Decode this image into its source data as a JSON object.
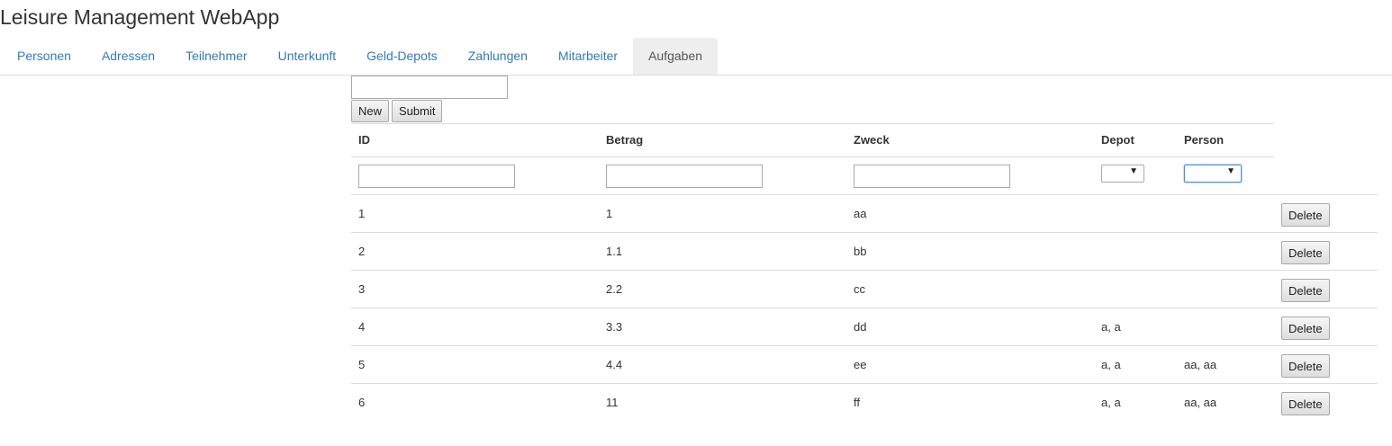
{
  "app": {
    "title": "Leisure Management WebApp"
  },
  "nav": {
    "tabs": [
      {
        "label": "Personen",
        "active": false
      },
      {
        "label": "Adressen",
        "active": false
      },
      {
        "label": "Teilnehmer",
        "active": false
      },
      {
        "label": "Unterkunft",
        "active": false
      },
      {
        "label": "Geld-Depots",
        "active": false
      },
      {
        "label": "Zahlungen",
        "active": false
      },
      {
        "label": "Mitarbeiter",
        "active": false
      },
      {
        "label": "Aufgaben",
        "active": true
      }
    ]
  },
  "toolbar": {
    "search_value": "",
    "new_label": "New",
    "submit_label": "Submit"
  },
  "table": {
    "columns": [
      "ID",
      "Betrag",
      "Zweck",
      "Depot",
      "Person"
    ],
    "filters": {
      "id": "",
      "betrag": "",
      "zweck": "",
      "depot": "",
      "person": ""
    },
    "rows": [
      {
        "id": "1",
        "betrag": "1",
        "zweck": "aa",
        "depot": "",
        "person": ""
      },
      {
        "id": "2",
        "betrag": "1.1",
        "zweck": "bb",
        "depot": "",
        "person": ""
      },
      {
        "id": "3",
        "betrag": "2.2",
        "zweck": "cc",
        "depot": "",
        "person": ""
      },
      {
        "id": "4",
        "betrag": "3.3",
        "zweck": "dd",
        "depot": "a, a",
        "person": ""
      },
      {
        "id": "5",
        "betrag": "4.4",
        "zweck": "ee",
        "depot": "a, a",
        "person": "aa, aa"
      },
      {
        "id": "6",
        "betrag": "11",
        "zweck": "ff",
        "depot": "a, a",
        "person": "aa, aa"
      }
    ],
    "delete_label": "Delete"
  },
  "colors": {
    "link": "#337ab7",
    "active_tab_bg": "#eeeeee",
    "border": "#dddddd"
  }
}
